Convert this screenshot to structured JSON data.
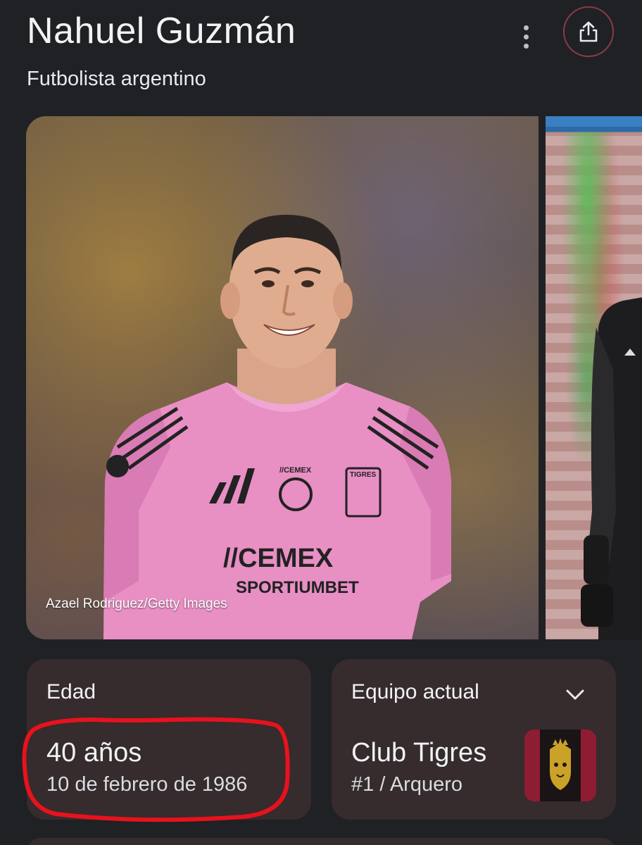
{
  "header": {
    "title": "Nahuel Guzmán",
    "subtitle": "Futbolista argentino",
    "more_icon": "more-vert-icon",
    "share_icon": "share-icon"
  },
  "carousel": {
    "main_photo": {
      "credit": "Azael Rodriguez/Getty Images",
      "jersey_color": "#e88fc4"
    }
  },
  "cards": {
    "age": {
      "label": "Edad",
      "value": "40 años",
      "detail": "10 de febrero de 1986"
    },
    "team": {
      "label": "Equipo actual",
      "value": "Club Tigres",
      "detail": "#1 / Arquero",
      "expand_icon": "chevron-down-icon"
    }
  },
  "colors": {
    "background": "#202124",
    "card": "#362b2d",
    "share_ring": "#8a3a45",
    "annotation": "#e8121c",
    "team_logo_bg": "#8e1d33"
  }
}
